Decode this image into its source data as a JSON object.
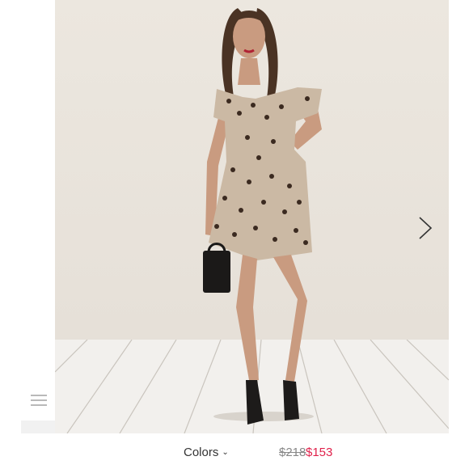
{
  "listing": {
    "colors_label": "Colors",
    "original_price": "$218",
    "sale_price": "$153"
  },
  "icons": {
    "menu": "hamburger-menu-icon",
    "next": "chevron-right-icon",
    "dropdown": "chevron-down-icon"
  },
  "colors": {
    "sale_price": "#e0214b",
    "original_price": "#888888",
    "text": "#333333"
  }
}
